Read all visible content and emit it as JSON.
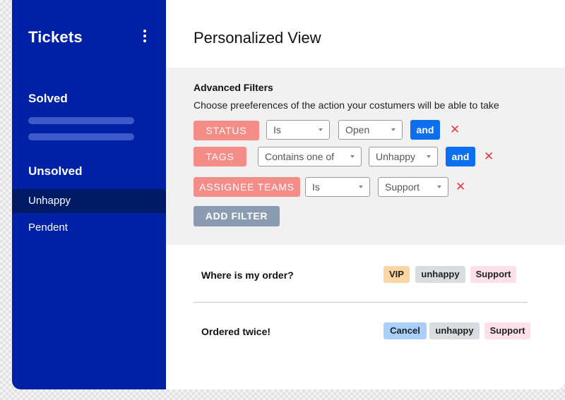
{
  "sidebar": {
    "title": "Tickets",
    "solved_label": "Solved",
    "unsolved_label": "Unsolved",
    "items": [
      {
        "label": "Unhappy"
      },
      {
        "label": "Pendent"
      }
    ]
  },
  "main": {
    "title": "Personalized View",
    "filters": {
      "title": "Advanced Filters",
      "description": "Choose preeferences of the action your costumers will be able to take",
      "rows": [
        {
          "field": "STATUS",
          "operator": "Is",
          "value": "Open",
          "connector": "and"
        },
        {
          "field": "TAGS",
          "operator": "Contains one of",
          "value": "Unhappy",
          "connector": "and"
        },
        {
          "field": "ASSIGNEE TEAMS",
          "operator": "Is",
          "value": "Support"
        }
      ],
      "add_label": "ADD FILTER"
    },
    "tickets": [
      {
        "title": "Where is my order?",
        "tags": [
          "VIP",
          "unhappy",
          "Support"
        ]
      },
      {
        "title": "Ordered twice!",
        "tags": [
          "Cancel",
          "unhappy",
          "Support"
        ]
      }
    ]
  },
  "colors": {
    "sidebar": "#0021a5",
    "sidebar_active": "#001a66",
    "filter_chip": "#f48c88",
    "and_button": "#0b6ff0",
    "remove_icon": "#e53940",
    "add_filter": "#8a9bb2"
  }
}
